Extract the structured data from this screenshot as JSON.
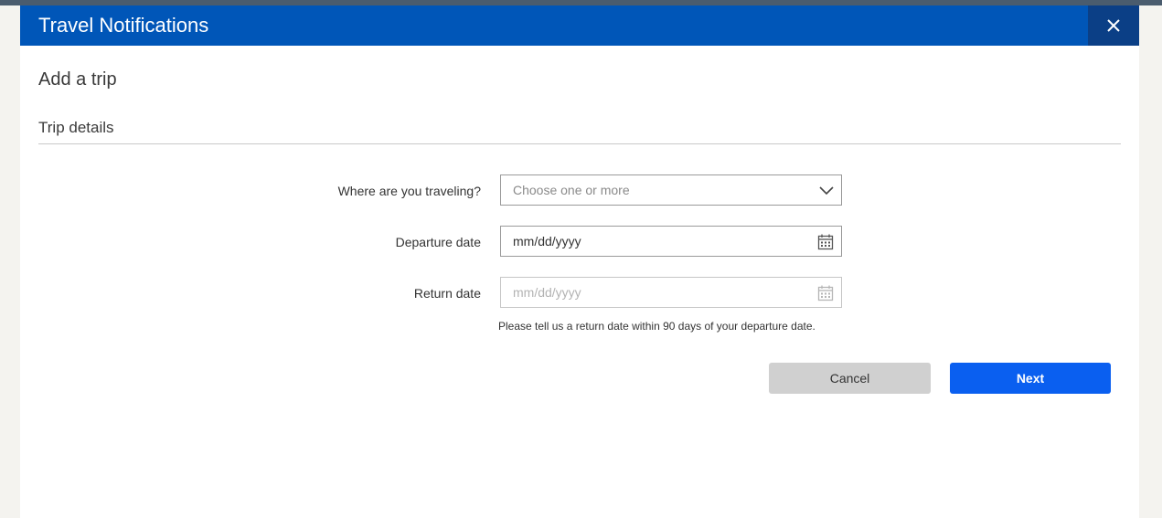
{
  "dialog": {
    "title": "Travel Notifications",
    "close_icon": "close-icon"
  },
  "page": {
    "title": "Add a trip",
    "section_title": "Trip details"
  },
  "form": {
    "destination": {
      "label": "Where are you traveling?",
      "placeholder": "Choose one or more",
      "icon": "chevron-down-icon"
    },
    "departure": {
      "label": "Departure date",
      "value": "mm/dd/yyyy",
      "icon": "calendar-icon"
    },
    "return": {
      "label": "Return date",
      "placeholder": "mm/dd/yyyy",
      "icon": "calendar-icon",
      "hint": "Please tell us a return date within 90 days of your departure date."
    }
  },
  "buttons": {
    "cancel": "Cancel",
    "next": "Next"
  },
  "colors": {
    "header": "#0056b8",
    "close_bg": "#0b3f86",
    "primary": "#0a5ff0",
    "secondary": "#d0d0d0"
  }
}
